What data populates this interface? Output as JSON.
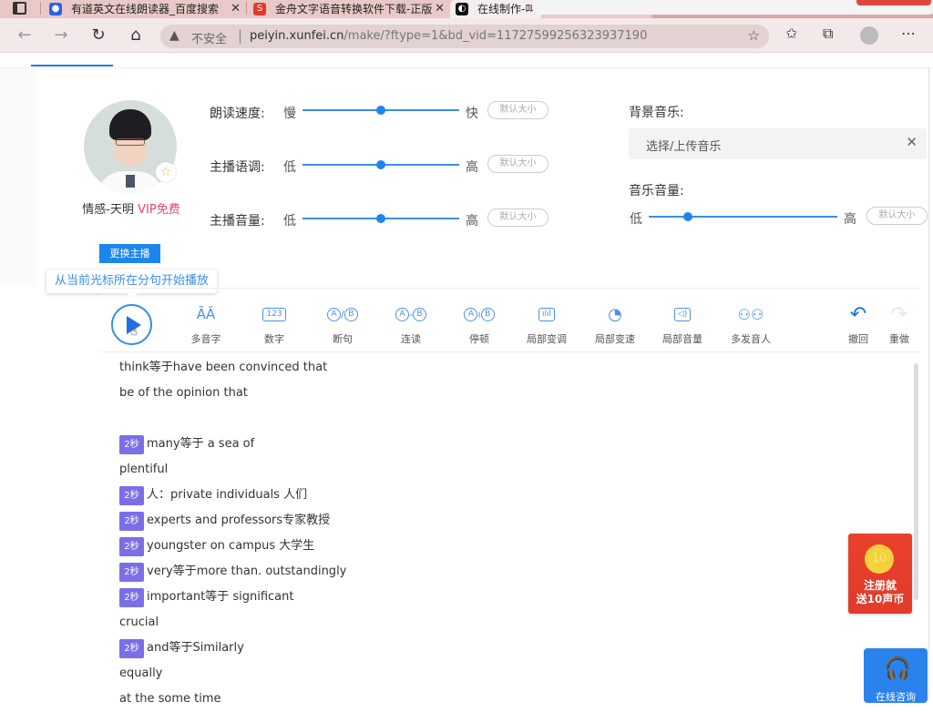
{
  "browser": {
    "tabs": [
      {
        "title": "有道英文在线朗读器_百度搜索",
        "icon": "baidu-paw-icon",
        "active": false
      },
      {
        "title": "金舟文字语音转换软件下载-正版",
        "icon": "jinzhou-logo-icon",
        "active": false
      },
      {
        "title": "在线制作-叫",
        "icon": "xunfei-logo-icon",
        "active": true
      }
    ],
    "address": {
      "security_label": "不安全",
      "url_host": "peiyin.xunfei.cn",
      "url_rest": "/make/?ftype=1&bd_vid=11727599256323937190"
    }
  },
  "voice": {
    "name": "情感-天明",
    "vip_label": "VIP免费",
    "change_button": "更换主播"
  },
  "params": {
    "speed": {
      "label": "朗读速度:",
      "low": "慢",
      "high": "快",
      "value": 0.5,
      "default_btn": "默认大小"
    },
    "pitch": {
      "label": "主播语调:",
      "low": "低",
      "high": "高",
      "value": 0.5,
      "default_btn": "默认大小"
    },
    "volume": {
      "label": "主播音量:",
      "low": "低",
      "high": "高",
      "value": 0.5,
      "default_btn": "默认大小"
    }
  },
  "background_music": {
    "label": "背景音乐:",
    "select_placeholder": "选择/上传音乐",
    "volume_label": "音乐音量:",
    "volume_low": "低",
    "volume_high": "高",
    "volume_value": 0.21,
    "default_btn": "默认大小"
  },
  "tooltip": "从当前光标所在分句开始播放",
  "toolbar": {
    "tools": [
      {
        "label": "多音字",
        "icon": "polyphone-icon"
      },
      {
        "label": "数字",
        "icon": "number-icon"
      },
      {
        "label": "断句",
        "icon": "sentence-break-icon"
      },
      {
        "label": "连读",
        "icon": "liaison-icon"
      },
      {
        "label": "停顿",
        "icon": "pause-icon"
      },
      {
        "label": "局部变调",
        "icon": "local-pitch-icon"
      },
      {
        "label": "局部变速",
        "icon": "local-speed-icon"
      },
      {
        "label": "局部音量",
        "icon": "local-volume-icon"
      },
      {
        "label": "多发音人",
        "icon": "multi-speaker-icon"
      }
    ],
    "undo": "撤回",
    "redo": "重做"
  },
  "editor": {
    "lines": [
      {
        "pause": null,
        "text": "think等于have been convinced that"
      },
      {
        "pause": null,
        "text": "be of the opinion that"
      },
      {
        "pause": null,
        "text": ""
      },
      {
        "pause": "2秒",
        "text": "many等于 a sea of"
      },
      {
        "pause": null,
        "text": "plentiful"
      },
      {
        "pause": "2秒",
        "text": "人：private individuals 人们"
      },
      {
        "pause": "2秒",
        "text": "experts and professors专家教授"
      },
      {
        "pause": "2秒",
        "text": "youngster on campus 大学生"
      },
      {
        "pause": "2秒",
        "text": "very等于more than. outstandingly"
      },
      {
        "pause": "2秒",
        "text": "important等于 significant"
      },
      {
        "pause": null,
        "text": "crucial"
      },
      {
        "pause": "2秒",
        "text": "and等于Similarly"
      },
      {
        "pause": null,
        "text": "equally"
      },
      {
        "pause": null,
        "text": "at the some time"
      }
    ]
  },
  "promo": {
    "coin": "10",
    "line1": "注册就",
    "line2": "送10声币"
  },
  "support": {
    "label": "在线咨询"
  }
}
